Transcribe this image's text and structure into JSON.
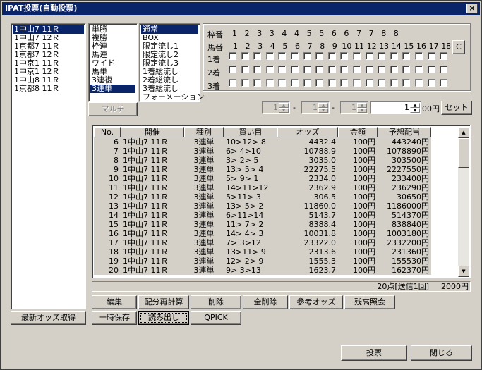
{
  "title": "IPAT投票(自動投票)",
  "close_glyph": "×",
  "races": [
    {
      "label": "1中山7  11Ｒ",
      "selected": true
    },
    {
      "label": "1中山7  12Ｒ",
      "selected": false
    },
    {
      "label": "1京都7  11Ｒ",
      "selected": false
    },
    {
      "label": "1京都7  12Ｒ",
      "selected": false
    },
    {
      "label": "1中京1  11Ｒ",
      "selected": false
    },
    {
      "label": "1中京1  12Ｒ",
      "selected": false
    },
    {
      "label": "1中山8  11Ｒ",
      "selected": false
    },
    {
      "label": "1京都8  11Ｒ",
      "selected": false
    }
  ],
  "bet_types": [
    {
      "label": "単勝",
      "selected": false
    },
    {
      "label": "複勝",
      "selected": false
    },
    {
      "label": "枠連",
      "selected": false
    },
    {
      "label": "馬連",
      "selected": false
    },
    {
      "label": "ワイド",
      "selected": false
    },
    {
      "label": "馬単",
      "selected": false
    },
    {
      "label": "3連複",
      "selected": false
    },
    {
      "label": "3連単",
      "selected": true
    }
  ],
  "methods": [
    {
      "label": "通常",
      "selected": true
    },
    {
      "label": "BOX",
      "selected": false
    },
    {
      "label": "限定流し1",
      "selected": false
    },
    {
      "label": "限定流し2",
      "selected": false
    },
    {
      "label": "限定流し3",
      "selected": false
    },
    {
      "label": "1着総流し",
      "selected": false
    },
    {
      "label": "2着総流し",
      "selected": false
    },
    {
      "label": "3着総流し",
      "selected": false
    },
    {
      "label": "フォーメーション",
      "selected": false
    }
  ],
  "multi_button": "マルチ",
  "frame_label": "枠番",
  "frame_numbers": [
    "1",
    "2",
    "3",
    "3",
    "4",
    "4",
    "5",
    "5",
    "6",
    "6",
    "7",
    "7",
    "8",
    "8"
  ],
  "horse_label": "馬番",
  "horse_numbers": [
    "1",
    "2",
    "3",
    "4",
    "5",
    "6",
    "7",
    "8",
    "9",
    "10",
    "11",
    "12",
    "13",
    "14",
    "15",
    "16",
    "17",
    "18"
  ],
  "rank_labels": [
    "1着",
    "2着",
    "3着"
  ],
  "c_button": "C",
  "spin1": "1",
  "spin2": "1",
  "spin3": "1",
  "dash": "-",
  "amount_value": "1",
  "amount_unit": "00円",
  "set_button": "セット",
  "columns": [
    "No.",
    "開催",
    "種別",
    "買い目",
    "オッズ",
    "金額",
    "予想配当"
  ],
  "bets": [
    [
      "6",
      "1中山7  11Ｒ",
      "3連単",
      "10>12> 8",
      "4432.4",
      "100円",
      "443240円"
    ],
    [
      "7",
      "1中山7  11Ｒ",
      "3連単",
      "6> 4>10",
      "10788.9",
      "100円",
      "1078890円"
    ],
    [
      "8",
      "1中山7  11Ｒ",
      "3連単",
      "3> 2> 5",
      "3035.0",
      "100円",
      "303500円"
    ],
    [
      "9",
      "1中山7  11Ｒ",
      "3連単",
      "13> 5> 4",
      "22275.5",
      "100円",
      "2227550円"
    ],
    [
      "10",
      "1中山7  11Ｒ",
      "3連単",
      "5> 9> 1",
      "2334.0",
      "100円",
      "233400円"
    ],
    [
      "11",
      "1中山7  11Ｒ",
      "3連単",
      "14>11>12",
      "2362.9",
      "100円",
      "236290円"
    ],
    [
      "12",
      "1中山7  11Ｒ",
      "3連単",
      "5>11> 3",
      "306.5",
      "100円",
      "30650円"
    ],
    [
      "13",
      "1中山7  11Ｒ",
      "3連単",
      "13> 5> 2",
      "11860.0",
      "100円",
      "1186000円"
    ],
    [
      "14",
      "1中山7  11Ｒ",
      "3連単",
      "6>11>14",
      "5143.7",
      "100円",
      "514370円"
    ],
    [
      "15",
      "1中山7  11Ｒ",
      "3連単",
      "11> 7> 2",
      "8388.4",
      "100円",
      "838840円"
    ],
    [
      "16",
      "1中山7  11Ｒ",
      "3連単",
      "14> 4> 3",
      "10031.8",
      "100円",
      "1003180円"
    ],
    [
      "17",
      "1中山7  11Ｒ",
      "3連単",
      "7> 3>12",
      "23322.0",
      "100円",
      "2332200円"
    ],
    [
      "18",
      "1中山7  11Ｒ",
      "3連単",
      "13>11> 9",
      "2313.6",
      "100円",
      "231360円"
    ],
    [
      "19",
      "1中山7  11Ｒ",
      "3連単",
      "12> 2> 9",
      "1555.3",
      "100円",
      "155530円"
    ],
    [
      "20",
      "1中山7  11Ｒ",
      "3連単",
      "9> 3>13",
      "1623.7",
      "100円",
      "162370円"
    ]
  ],
  "status_points": "20点[送信1回]",
  "status_total": "2000円",
  "buttons": {
    "edit": "編集",
    "recalc": "配分再計算",
    "delete": "削除",
    "delete_all": "全削除",
    "ref_odds": "参考オッズ",
    "balance": "残高照会",
    "fetch_odds": "最新オッズ取得",
    "temp_save": "一時保存",
    "load": "読み出し",
    "qpick": "QPICK",
    "vote": "投票",
    "close": "閉じる"
  }
}
